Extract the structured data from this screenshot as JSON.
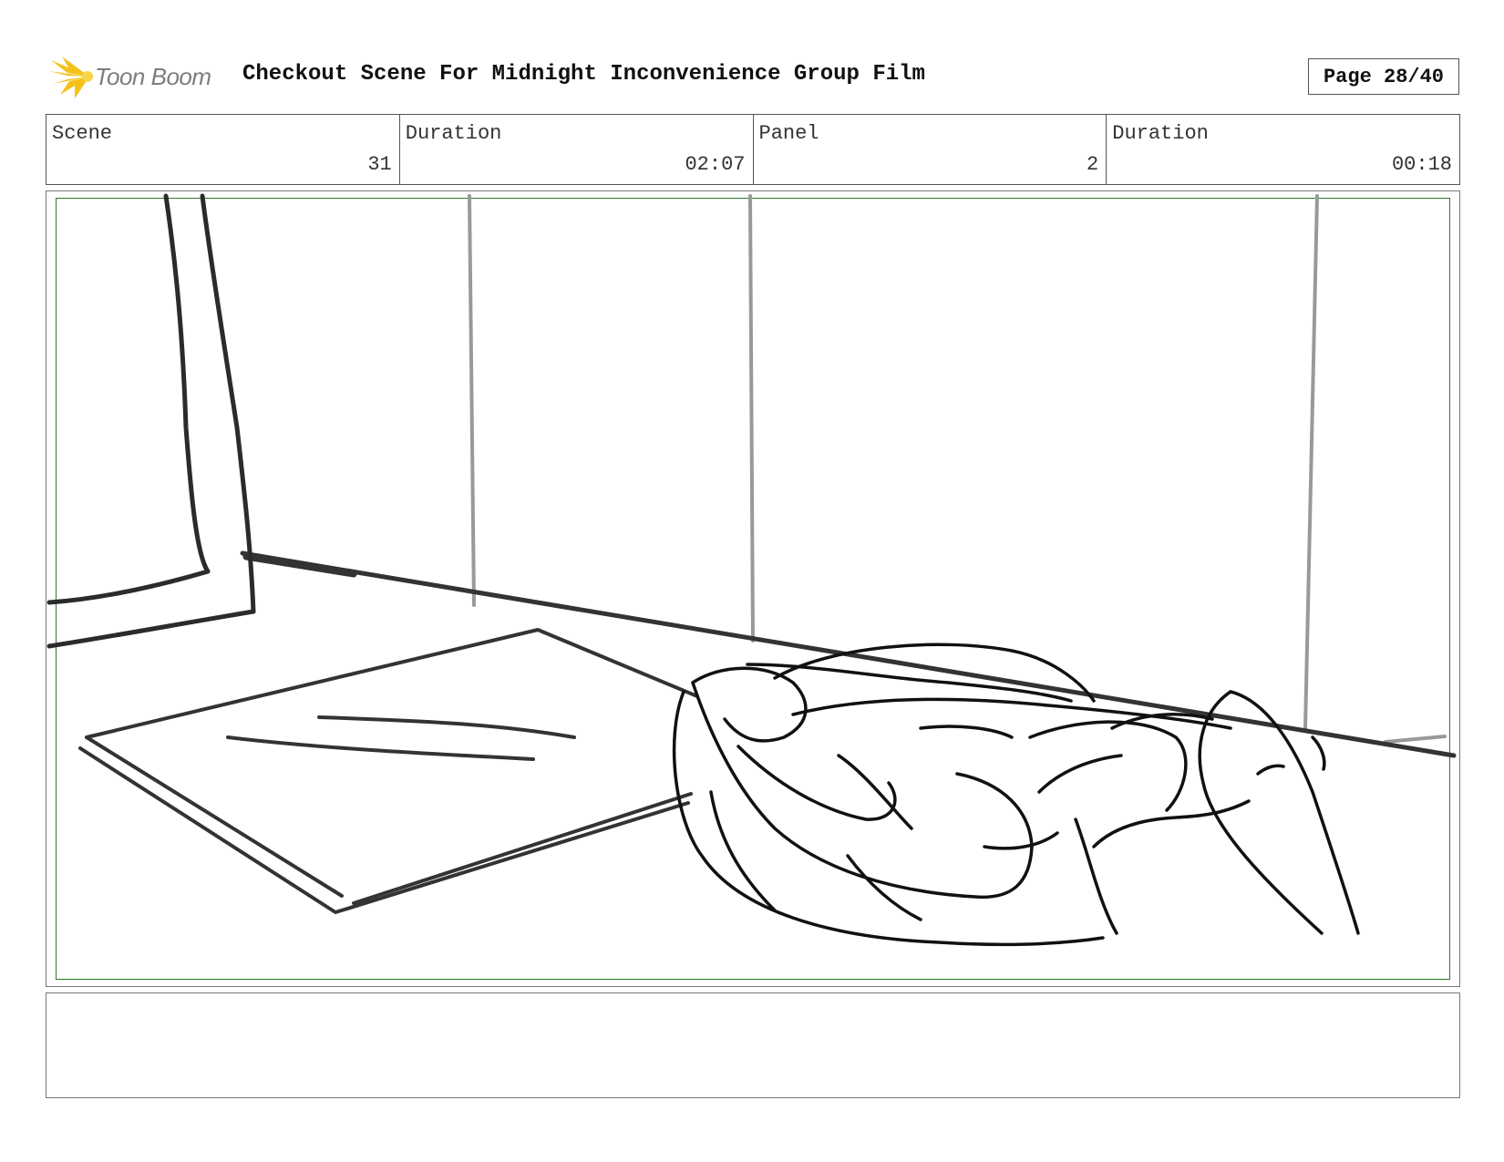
{
  "header": {
    "logo_text": "Toon Boom",
    "logo_icon": "toon-boom-burst-icon",
    "title": "Checkout Scene For Midnight Inconvenience Group Film",
    "page": "Page 28/40"
  },
  "info": {
    "scene_label": "Scene",
    "scene_value": "31",
    "scene_duration_label": "Duration",
    "scene_duration_value": "02:07",
    "panel_label": "Panel",
    "panel_value": "2",
    "panel_duration_label": "Duration",
    "panel_duration_value": "00:18"
  },
  "panel": {
    "safe_frame_color": "#2a7a2a",
    "sketch_subject": "hand resting on a counter next to a flat card"
  },
  "notes": {
    "text": ""
  }
}
